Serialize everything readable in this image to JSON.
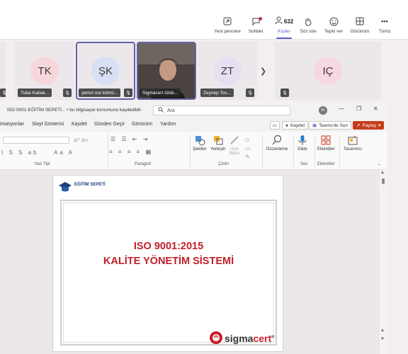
{
  "teams_toolbar": {
    "items": [
      {
        "label": "Yeni pencere",
        "icon": "popout-icon"
      },
      {
        "label": "Sohbet",
        "icon": "chat-icon",
        "has_notification": true
      },
      {
        "label": "Kişiler",
        "icon": "people-icon",
        "count": "632",
        "active": true
      },
      {
        "label": "Söz iste",
        "icon": "raise-hand-icon"
      },
      {
        "label": "Tepki ver",
        "icon": "emoji-icon"
      },
      {
        "label": "Görünüm",
        "icon": "grid-icon"
      },
      {
        "label": "Tümü",
        "icon": "more-icon"
      }
    ]
  },
  "participants": [
    {
      "initials": "TK",
      "name": "Tuba Kabak...",
      "avatar_color": "#f7d7dc"
    },
    {
      "initials": "ŞK",
      "name": "şemsi nur kömü...",
      "avatar_color": "#d7e0f4",
      "speaking": true
    },
    {
      "initials": "",
      "name": "Sigmacert Glob...",
      "is_video": true,
      "speaking": true
    },
    {
      "initials": "ZT",
      "name": "Zeynep Tos...",
      "avatar_color": "#e6dff2"
    },
    {
      "initials": "IÇ",
      "name": "",
      "avatar_color": "#f6d8e0"
    }
  ],
  "powerpoint": {
    "doc_title": "ISO 9001-EĞİTİM SEPETİ...  •  bu bilgisayar konumuna kaydedildi",
    "search_placeholder": "Ara",
    "user_initials": "İG",
    "menu_tabs": [
      "imasyonlar",
      "Slayt Gösterisi",
      "Kaydet",
      "Gözden Geçir",
      "Görünüm",
      "Yardım"
    ],
    "buttons": {
      "kaydet": "Kaydet",
      "teams": "Teams'de Sun",
      "share": "Paylaş"
    },
    "ribbon": {
      "groups": [
        "Yazı Tipi",
        "Paragraf",
        "Çizim",
        "Ses",
        "Eklentiler"
      ],
      "buttons": {
        "sekiller": "Şekiller",
        "yerlestir": "Yerleştir",
        "hizli": "Hızlı",
        "bicim": "Biçim",
        "duzenleme": "Düzenleme",
        "dikte": "Dikte",
        "eklentiler": "Eklentiler",
        "tasarimci": "Tasarımcı"
      }
    },
    "slide": {
      "title_line1": "ISO 9001:2015",
      "title_line2": "KALİTE YÖNETİM SİSTEMİ",
      "title_color": "#c0202a",
      "egitim_logo_text": "EĞİTİM SEPETİ",
      "sigma_logo_part1": "sigma",
      "sigma_logo_part2": "cert",
      "sigma_logo_mark": "®"
    }
  }
}
